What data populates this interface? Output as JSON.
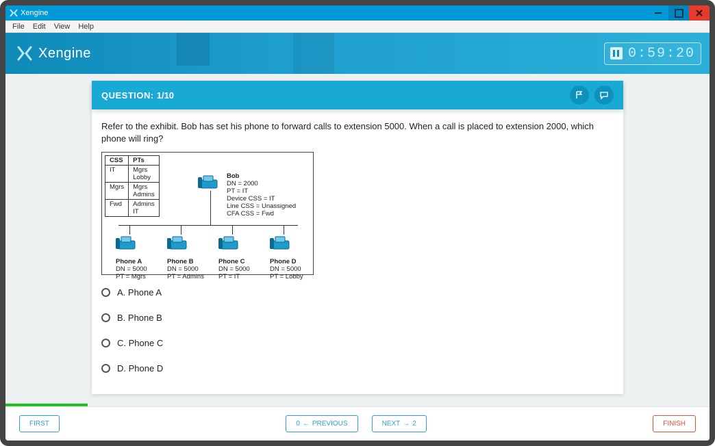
{
  "window": {
    "title": "Xengine"
  },
  "menu": {
    "file": "File",
    "edit": "Edit",
    "view": "View",
    "help": "Help"
  },
  "header": {
    "brand": "Xengine",
    "timer": "0:59:20"
  },
  "question": {
    "label": "QUESTION:",
    "number": "1/10",
    "text": "Refer to the exhibit. Bob has set his phone to forward calls to extension 5000. When a call is placed to extension 2000, which phone will ring?"
  },
  "exhibit": {
    "table": {
      "headers": [
        "CSS",
        "PTs"
      ],
      "rows": [
        [
          "IT",
          "Mgrs\nLobby"
        ],
        [
          "Mgrs",
          "Mgrs\nAdmins"
        ],
        [
          "Fwd",
          "Admins\nIT"
        ]
      ]
    },
    "bob": {
      "name": "Bob",
      "lines": [
        "DN = 2000",
        "PT = IT",
        "Device CSS = IT",
        "Line CSS = Unassigned",
        "CFA CSS = Fwd"
      ]
    },
    "phones": [
      {
        "name": "Phone A",
        "dn": "DN = 5000",
        "pt": "PT = Mgrs"
      },
      {
        "name": "Phone B",
        "dn": "DN = 5000",
        "pt": "PT = Admins"
      },
      {
        "name": "Phone C",
        "dn": "DN = 5000",
        "pt": "PT = IT"
      },
      {
        "name": "Phone D",
        "dn": "DN = 5000",
        "pt": "PT = Lobby"
      }
    ]
  },
  "options": {
    "a": "A. Phone A",
    "b": "B. Phone B",
    "c": "C. Phone C",
    "d": "D. Phone D"
  },
  "footer": {
    "first": "FIRST",
    "prev_num": "0",
    "prev": "PREVIOUS",
    "next": "NEXT",
    "next_num": "2",
    "finish": "FINISH"
  },
  "colors": {
    "accent": "#18a9d5",
    "danger": "#e74c3c"
  }
}
